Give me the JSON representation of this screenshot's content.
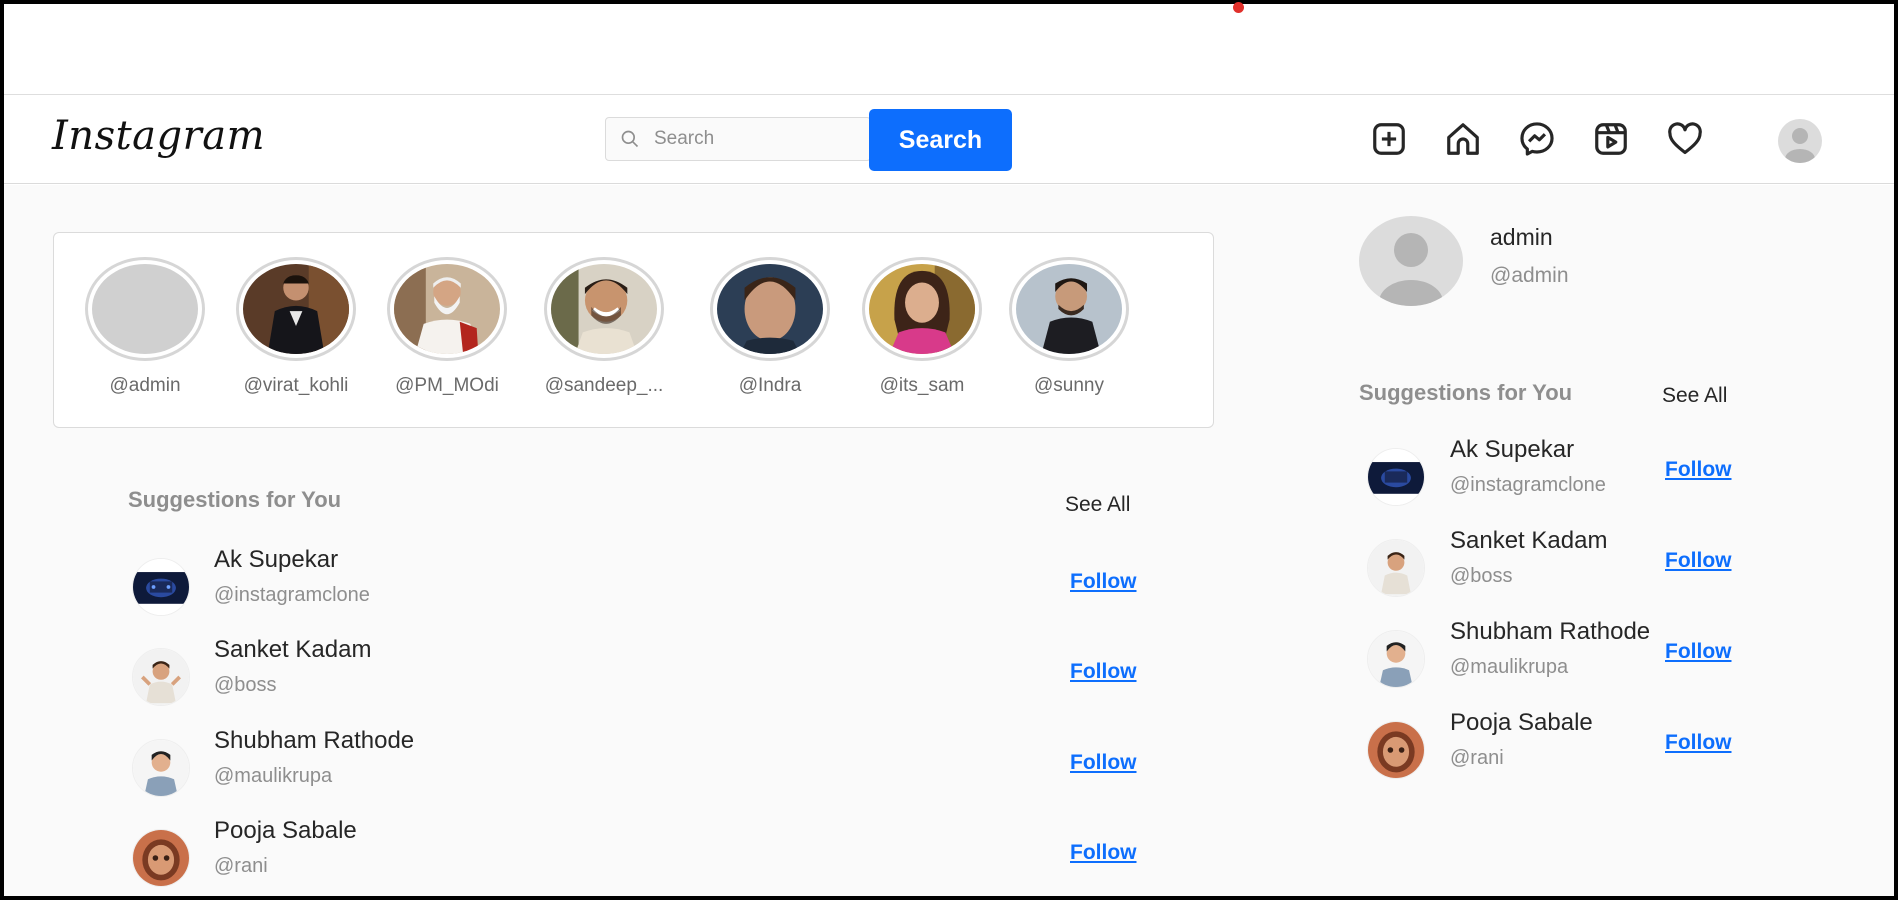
{
  "brand": {
    "logo": "Instagram"
  },
  "search": {
    "placeholder": "Search",
    "button_label": "Search"
  },
  "nav_icons": [
    "add-post-icon",
    "home-icon",
    "messenger-icon",
    "reels-icon",
    "heart-icon",
    "avatar"
  ],
  "stories": [
    {
      "username": "@admin",
      "image": "default-avatar"
    },
    {
      "username": "@virat_kohli",
      "image": "man-in-suit-photo"
    },
    {
      "username": "@PM_MOdi",
      "image": "bearded-man-photo"
    },
    {
      "username": "@sandeep_...",
      "image": "smiling-man-photo"
    },
    {
      "username": "@Indra",
      "image": "man-portrait-photo"
    },
    {
      "username": "@its_sam",
      "image": "woman-portrait-photo"
    },
    {
      "username": "@sunny",
      "image": "man-in-jacket-photo"
    }
  ],
  "main_suggestions": {
    "title": "Suggestions for You",
    "see_all": "See All",
    "items": [
      {
        "name": "Ak Supekar",
        "handle": "@instagramclone",
        "action": "Follow",
        "avatar": "dark-blue-banner"
      },
      {
        "name": "Sanket Kadam",
        "handle": "@boss",
        "action": "Follow",
        "avatar": "cartoon-boy"
      },
      {
        "name": "Shubham Rathode",
        "handle": "@maulikrupa",
        "action": "Follow",
        "avatar": "cartoon-man"
      },
      {
        "name": "Pooja Sabale",
        "handle": "@rani",
        "action": "Follow",
        "avatar": "cartoon-girl"
      }
    ]
  },
  "profile": {
    "name": "admin",
    "handle": "@admin"
  },
  "side_suggestions": {
    "title": "Suggestions for You",
    "see_all": "See All",
    "items": [
      {
        "name": "Ak Supekar",
        "handle": "@instagramclone",
        "action": "Follow"
      },
      {
        "name": "Sanket Kadam",
        "handle": "@boss",
        "action": "Follow"
      },
      {
        "name": "Shubham Rathode",
        "handle": "@maulikrupa",
        "action": "Follow"
      },
      {
        "name": "Pooja Sabale",
        "handle": "@rani",
        "action": "Follow"
      }
    ]
  },
  "colors": {
    "accent": "#0d6efd",
    "muted_text": "#8e8e8e",
    "border": "#dbdbdb",
    "background": "#fafafa"
  }
}
